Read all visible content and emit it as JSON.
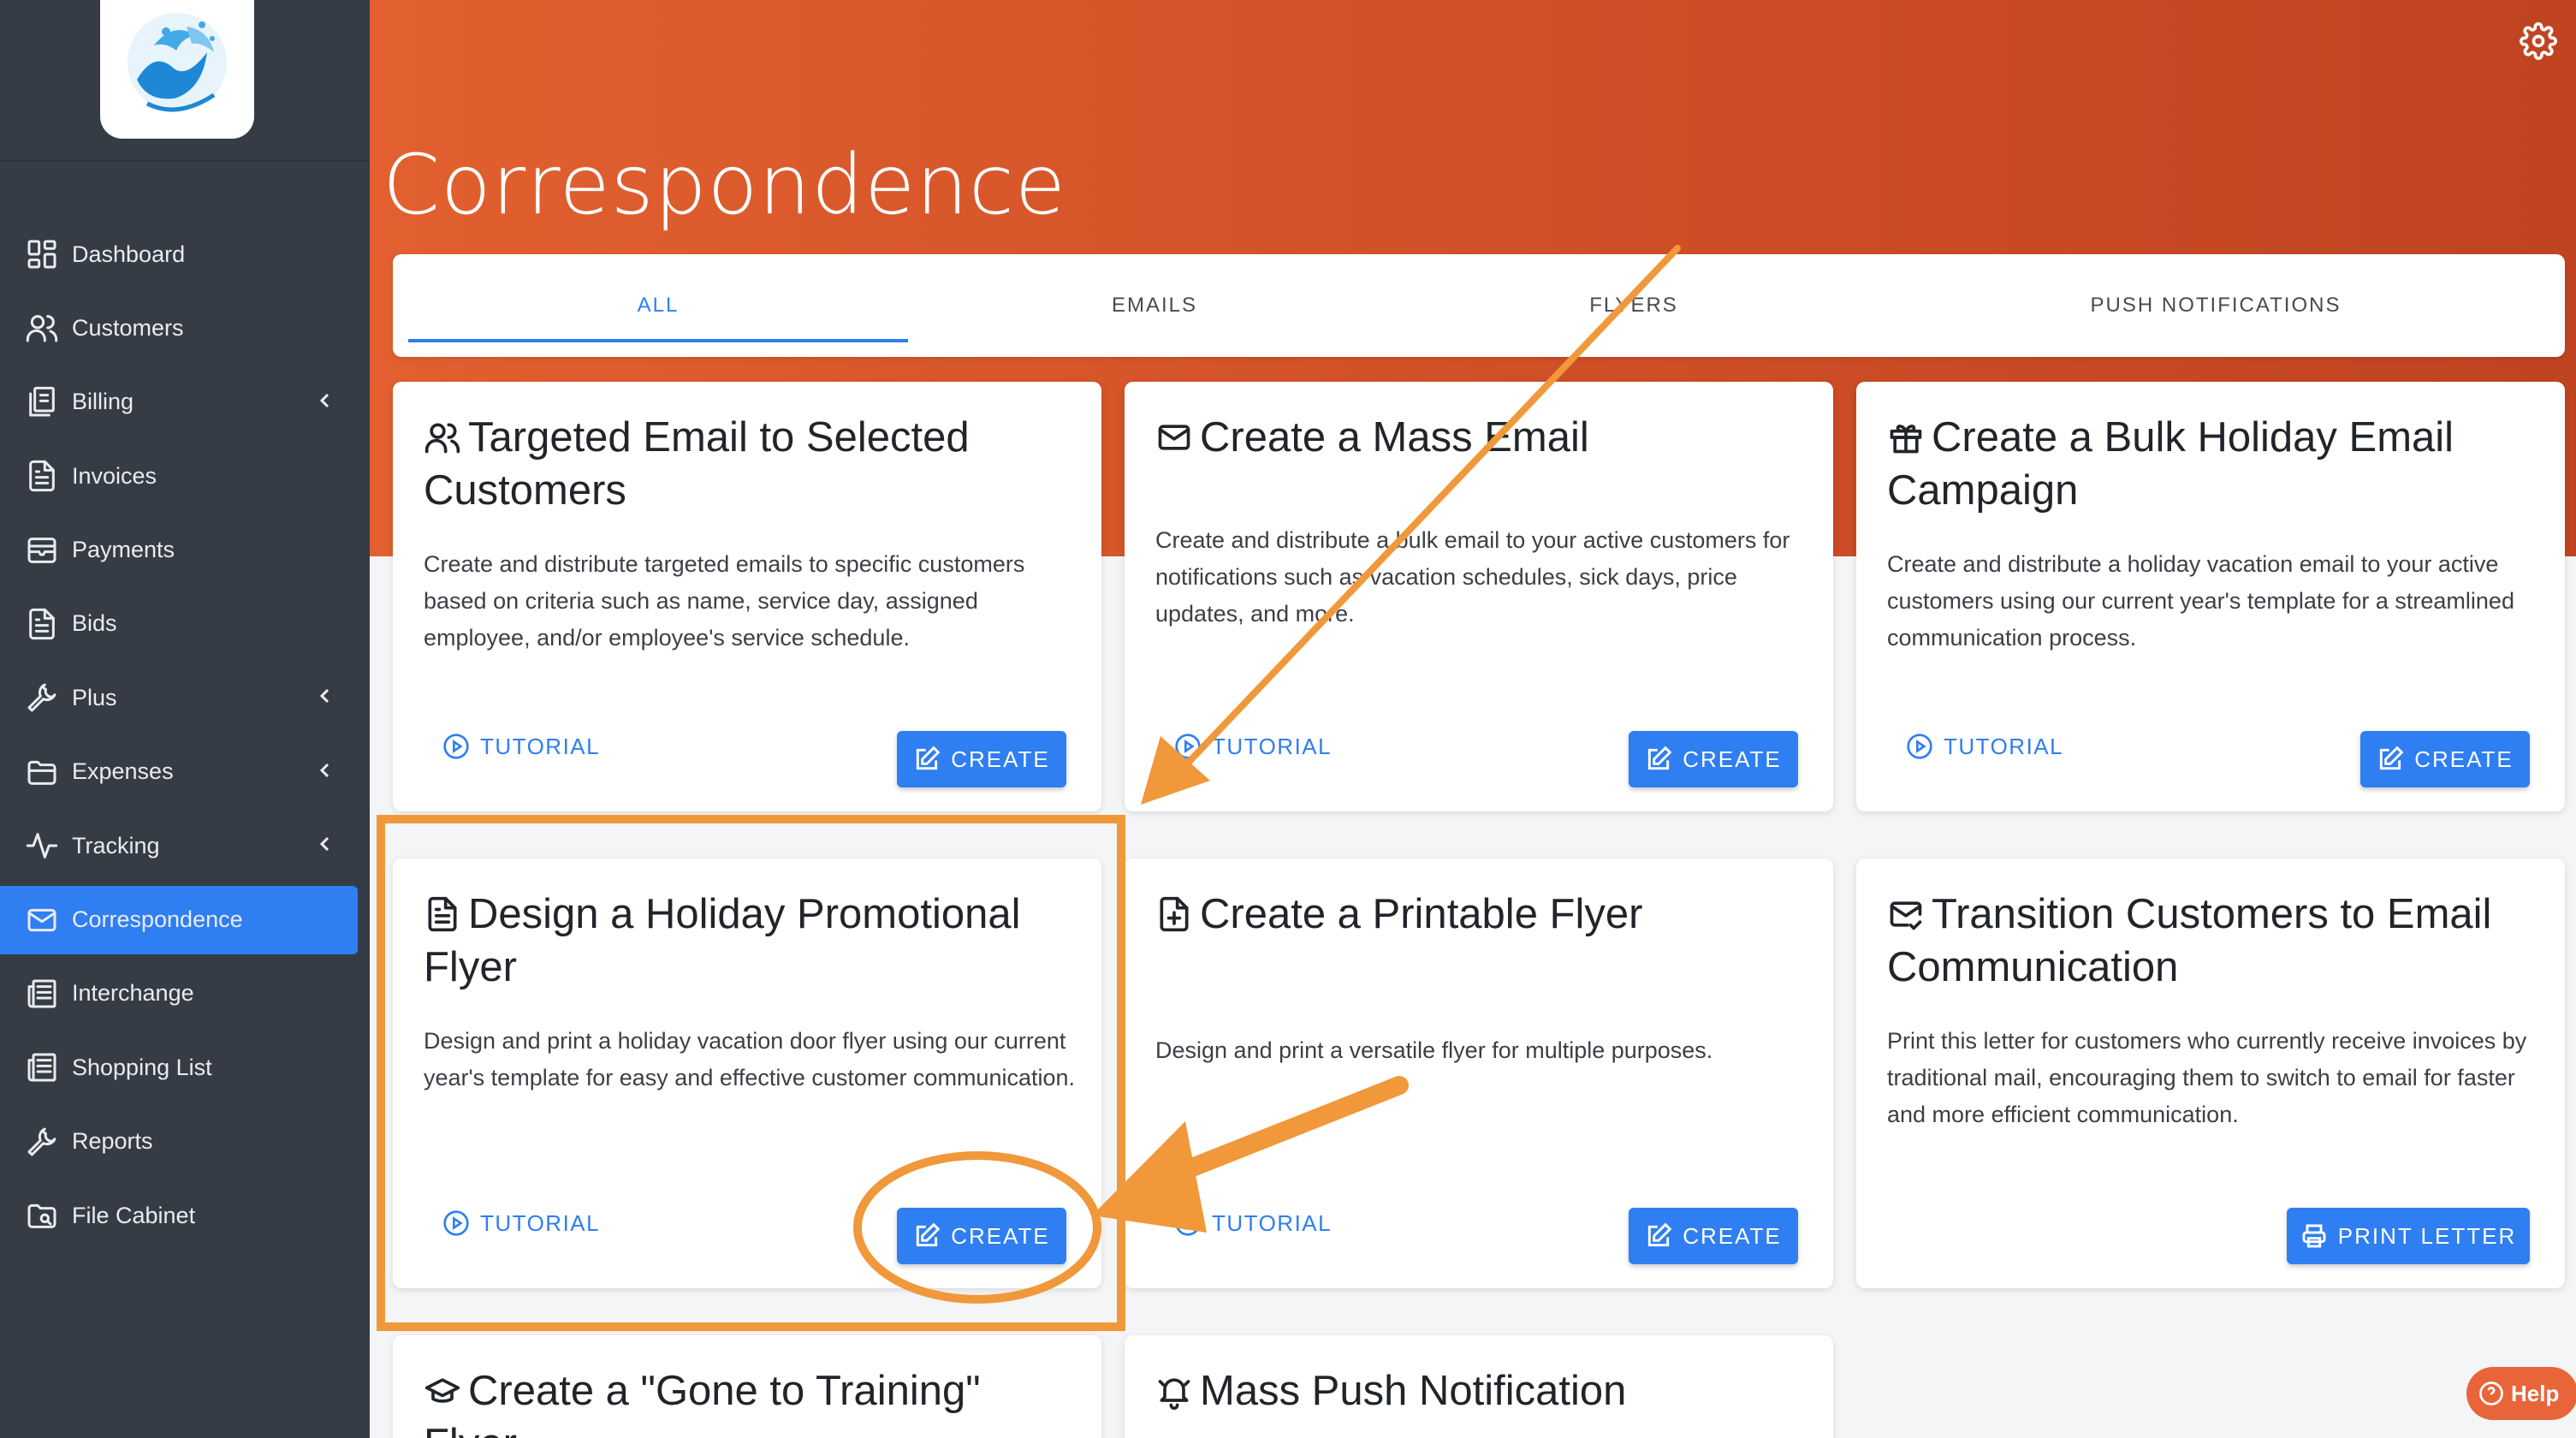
{
  "sidebar": {
    "items": [
      {
        "label": "Dashboard",
        "icon": "dashboard-icon"
      },
      {
        "label": "Customers",
        "icon": "users-icon"
      },
      {
        "label": "Billing",
        "icon": "billing-icon",
        "expandable": true
      },
      {
        "label": "Invoices",
        "icon": "document-icon"
      },
      {
        "label": "Payments",
        "icon": "wallet-icon"
      },
      {
        "label": "Bids",
        "icon": "document-icon"
      },
      {
        "label": "Plus",
        "icon": "wrench-icon",
        "expandable": true
      },
      {
        "label": "Expenses",
        "icon": "folder-icon",
        "expandable": true
      },
      {
        "label": "Tracking",
        "icon": "pulse-icon",
        "expandable": true
      },
      {
        "label": "Correspondence",
        "icon": "mail-icon",
        "active": true
      },
      {
        "label": "Interchange",
        "icon": "newspaper-icon"
      },
      {
        "label": "Shopping List",
        "icon": "newspaper-icon"
      },
      {
        "label": "Reports",
        "icon": "wrench-icon"
      },
      {
        "label": "File Cabinet",
        "icon": "folder-search-icon"
      }
    ]
  },
  "header": {
    "title": "Correspondence"
  },
  "tabs": [
    {
      "label": "ALL",
      "active": true
    },
    {
      "label": "EMAILS"
    },
    {
      "label": "FLYERS"
    },
    {
      "label": "PUSH NOTIFICATIONS"
    }
  ],
  "cards": [
    {
      "title": "Targeted Email to Selected Customers",
      "icon": "users-icon",
      "description": "Create and distribute targeted emails to specific customers based on criteria such as name, service day, assigned employee, and/or employee's service schedule.",
      "tutorial": "TUTORIAL",
      "action": "CREATE"
    },
    {
      "title": "Create a Mass Email",
      "icon": "mail-icon",
      "description": "Create and distribute a bulk email to your active customers for notifications such as vacation schedules, sick days, price updates, and more.",
      "tutorial": "TUTORIAL",
      "action": "CREATE"
    },
    {
      "title": "Create a Bulk Holiday Email Campaign",
      "icon": "gift-icon",
      "description": "Create and distribute a holiday vacation email to your active customers using our current year's template for a streamlined communication process.",
      "tutorial": "TUTORIAL",
      "action": "CREATE"
    },
    {
      "title": "Design a Holiday Promotional Flyer",
      "icon": "document-icon",
      "description": "Design and print a holiday vacation door flyer using our current year's template for easy and effective customer communication.",
      "tutorial": "TUTORIAL",
      "action": "CREATE"
    },
    {
      "title": "Create a Printable Flyer",
      "icon": "file-plus-icon",
      "description": "Design and print a versatile flyer for multiple purposes.",
      "tutorial": "TUTORIAL",
      "action": "CREATE"
    },
    {
      "title": "Transition Customers to Email Communication",
      "icon": "mail-check-icon",
      "description": "Print this letter for customers who currently receive invoices by traditional mail, encouraging them to switch to email for faster and more efficient communication.",
      "action": "PRINT LETTER"
    },
    {
      "title": "Create a \"Gone to Training\" Flyer",
      "icon": "graduation-cap-icon"
    },
    {
      "title": "Mass Push Notification",
      "icon": "bell-icon"
    }
  ],
  "help": {
    "label": "Help"
  },
  "colors": {
    "accent": "#2f7ef2",
    "header": "#d4542a",
    "sidebar": "#353c45",
    "annotation": "#f0983a"
  }
}
